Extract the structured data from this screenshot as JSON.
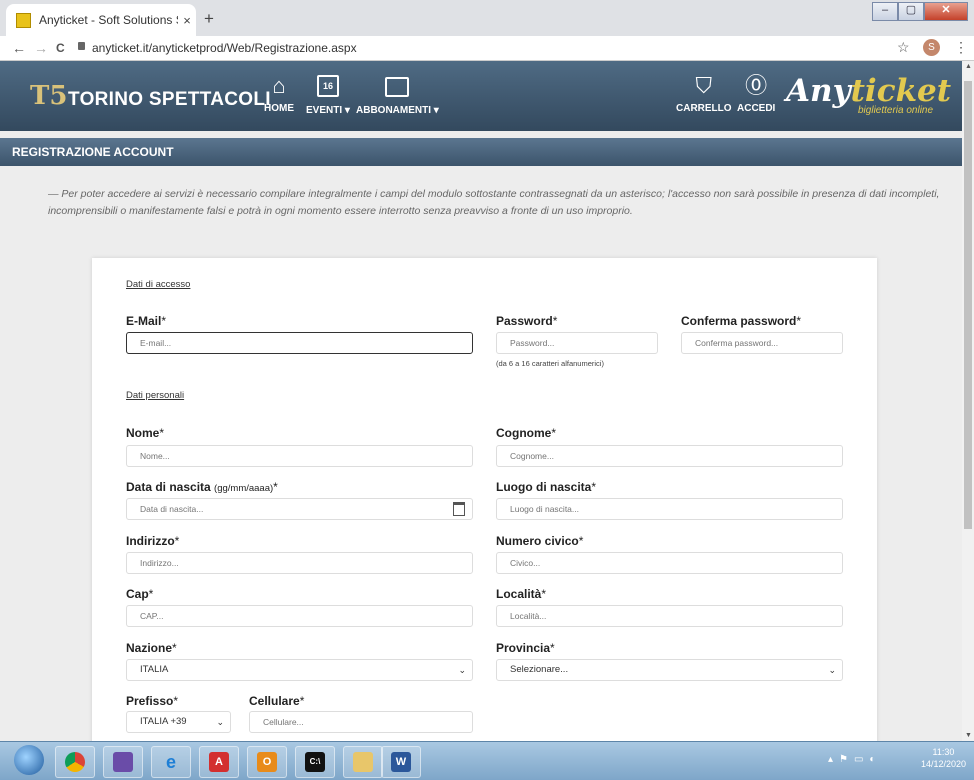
{
  "browser": {
    "tab_title": "Anyticket - Soft Solutions S.r.l.",
    "tab_close": "×",
    "new_tab": "+",
    "url": "anyticket.it/anyticketprod/Web/Registrazione.aspx",
    "back": "←",
    "forward": "→",
    "reload": "C",
    "star": "☆",
    "profile_initial": "S",
    "menu": "⋮",
    "win_min": "–",
    "win_max": "▢",
    "win_close": "✕"
  },
  "header": {
    "logo_mark": "T5",
    "logo_text": "TORINO SPETTACOLI",
    "nav": [
      {
        "label": "HOME",
        "icon": "home-icon"
      },
      {
        "label": "EVENTI ▾",
        "icon": "calendar-icon",
        "icon_text": "16"
      },
      {
        "label": "ABBONAMENTI ▾",
        "icon": "card-icon"
      }
    ],
    "cart_label": "CARRELLO",
    "login_label": "ACCEDI",
    "brand_a": "Any",
    "brand_b": "ticket",
    "brand_sub": "biglietteria online"
  },
  "page": {
    "title": "REGISTRAZIONE ACCOUNT",
    "intro": "— Per poter accedere ai servizi è necessario compilare integralmente i campi del modulo sottostante contrassegnati da un asterisco; l'accesso non sarà possibile in presenza di dati incompleti, incomprensibili o manifestamente falsi e potrà in ogni momento essere interrotto senza preavviso a fronte di un uso improprio."
  },
  "form": {
    "section_access": "Dati di accesso",
    "section_personal": "Dati personali",
    "email": {
      "label": "E-Mail",
      "placeholder": "E-mail..."
    },
    "password": {
      "label": "Password",
      "placeholder": "Password..."
    },
    "password_hint": "(da 6 a 16 caratteri alfanumerici)",
    "confirm": {
      "label": "Conferma password",
      "placeholder": "Conferma password..."
    },
    "nome": {
      "label": "Nome",
      "placeholder": "Nome..."
    },
    "cognome": {
      "label": "Cognome",
      "placeholder": "Cognome..."
    },
    "nascita": {
      "label": "Data di nascita ",
      "label_small": "(gg/mm/aaaa)",
      "placeholder": "Data di nascita..."
    },
    "luogo": {
      "label": "Luogo di nascita",
      "placeholder": "Luogo di nascita..."
    },
    "indirizzo": {
      "label": "Indirizzo",
      "placeholder": "Indirizzo..."
    },
    "civico": {
      "label": "Numero civico",
      "placeholder": "Civico..."
    },
    "cap": {
      "label": "Cap",
      "placeholder": "CAP..."
    },
    "localita": {
      "label": "Località",
      "placeholder": "Località..."
    },
    "nazione": {
      "label": "Nazione",
      "value": "ITALIA"
    },
    "provincia": {
      "label": "Provincia",
      "value": "Selezionare..."
    },
    "prefisso": {
      "label": "Prefisso",
      "value": "ITALIA +39"
    },
    "cellulare": {
      "label": "Cellulare",
      "placeholder": "Cellulare..."
    },
    "required_mark": "*"
  },
  "taskbar": {
    "apps": [
      "chrome",
      "hotspot",
      "internet-explorer",
      "acrobat",
      "outlook",
      "cmd",
      "file-explorer",
      "word"
    ],
    "time": "11:30",
    "date": "14/12/2020"
  }
}
